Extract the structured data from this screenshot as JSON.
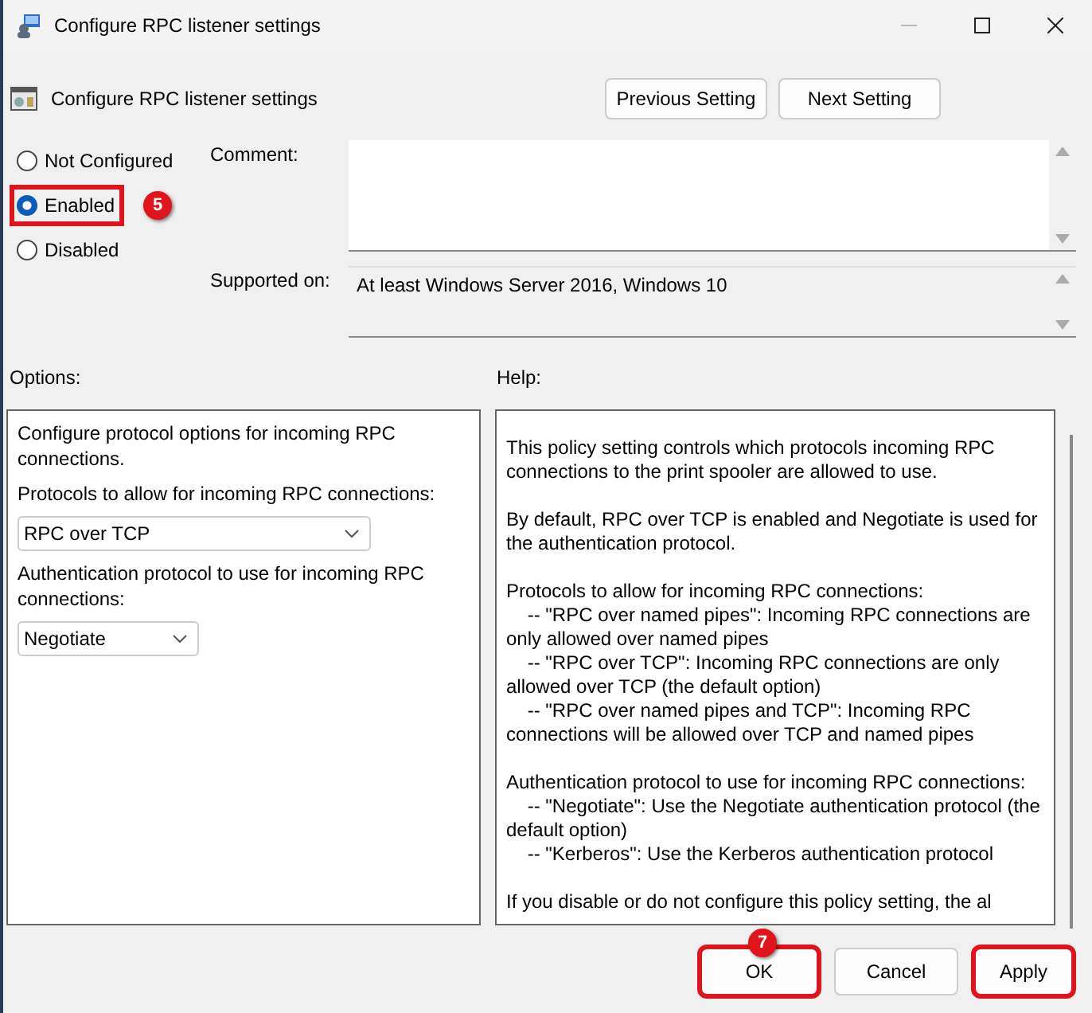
{
  "window": {
    "title": "Configure RPC listener settings"
  },
  "header": {
    "title": "Configure RPC listener settings",
    "buttons": [
      "Previous Setting",
      "Next Setting"
    ]
  },
  "state_options": [
    {
      "label": "Not Configured",
      "selected": false,
      "highlighted": false
    },
    {
      "label": "Enabled",
      "selected": true,
      "highlighted": true,
      "badge": "5"
    },
    {
      "label": "Disabled",
      "selected": false,
      "highlighted": false
    }
  ],
  "comment": {
    "label": "Comment:"
  },
  "supported_on": {
    "label": "Supported on:",
    "value": "At least Windows Server 2016, Windows 10"
  },
  "options": {
    "label": "Options:",
    "items": [
      {
        "kind": "text",
        "text": "Configure protocol options for incoming RPC connections."
      },
      {
        "kind": "text",
        "text": "Protocols to allow for incoming RPC connections:"
      },
      {
        "kind": "dropdown",
        "value": "RPC over TCP",
        "wide": true
      },
      {
        "kind": "text",
        "text": "Authentication protocol to use for incoming RPC connections:"
      },
      {
        "kind": "dropdown",
        "value": "Negotiate",
        "wide": false
      }
    ]
  },
  "help": {
    "label": "Help:",
    "paragraphs": [
      [
        "This policy setting controls which protocols incoming RPC connections to the print spooler are allowed to use."
      ],
      [
        "By default, RPC over TCP is enabled and Negotiate is used for the authentication protocol."
      ],
      [
        "Protocols to allow for incoming RPC connections:",
        "    -- \"RPC over named pipes\": Incoming RPC connections are only allowed over named pipes",
        "    -- \"RPC over TCP\": Incoming RPC connections are only allowed over TCP (the default option)",
        "    -- \"RPC over named pipes and TCP\": Incoming RPC connections will be allowed over TCP and named pipes"
      ],
      [
        "Authentication protocol to use for incoming RPC connections:",
        "    -- \"Negotiate\": Use the Negotiate authentication protocol (the default option)",
        "    -- \"Kerberos\": Use the Kerberos authentication protocol"
      ],
      [
        "If you disable or do not configure this policy setting, the al"
      ]
    ]
  },
  "buttons": [
    {
      "label": "OK",
      "highlighted": true,
      "badge": "7"
    },
    {
      "label": "Cancel",
      "highlighted": false
    },
    {
      "label": "Apply",
      "highlighted": true
    }
  ]
}
